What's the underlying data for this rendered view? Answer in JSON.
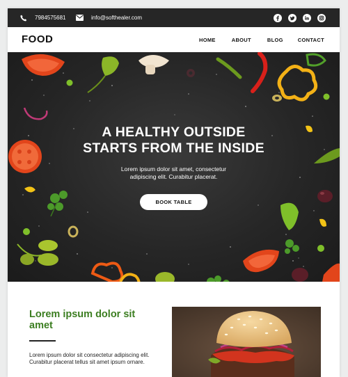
{
  "topbar": {
    "phone": "7984575681",
    "email": "info@softhealer.com",
    "socials": [
      "facebook-icon",
      "twitter-icon",
      "linkedin-icon",
      "instagram-icon"
    ]
  },
  "nav": {
    "logo": "FOOD",
    "menu": [
      "HOME",
      "ABOUT",
      "BLOG",
      "CONTACT"
    ]
  },
  "hero": {
    "title_line1": "A HEALTHY OUTSIDE",
    "title_line2": "STARTS FROM THE INSIDE",
    "text_line1": "Lorem ipsum dolor sit amet, consectetur",
    "text_line2": "adipiscing elit. Curabitur placerat.",
    "button": "BOOK TABLE"
  },
  "section": {
    "title": "Lorem ipsum dolor sit amet",
    "text": "Lorem ipsum dolor sit consectetur adipiscing elit. Curabitur placerat tellus sit amet ipsum ornare."
  },
  "colors": {
    "topbar": "#262626",
    "accent_green": "#3c7e21",
    "hero_bg": "#2a2a2a"
  }
}
